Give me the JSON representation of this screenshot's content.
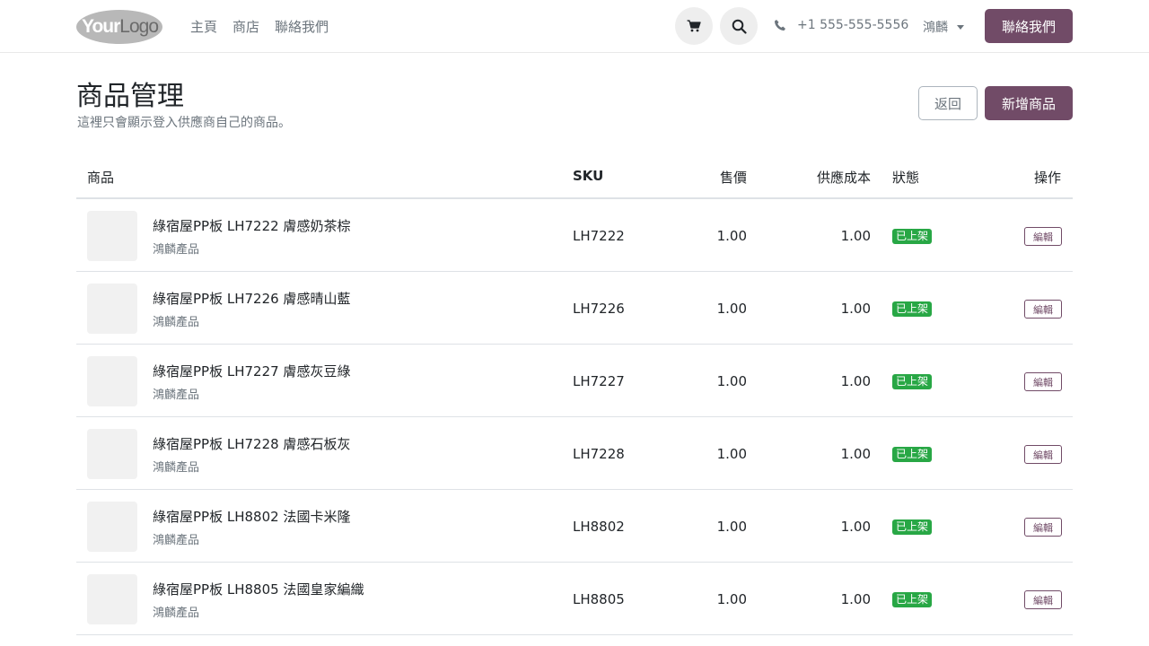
{
  "header": {
    "logo_text_a": "Your",
    "logo_text_b": "Logo",
    "nav": [
      "主頁",
      "商店",
      "聯絡我們"
    ],
    "phone": "+1 555-555-5556",
    "user": "鴻麟",
    "contact_label": "聯絡我們"
  },
  "page": {
    "title": "商品管理",
    "subtitle": "這裡只會顯示登入供應商自己的商品。",
    "back_label": "返回",
    "new_label": "新增商品"
  },
  "table": {
    "headers": {
      "product": "商品",
      "sku": "SKU",
      "price": "售價",
      "cost": "供應成本",
      "status": "狀態",
      "action": "操作"
    },
    "rows": [
      {
        "name": "綠宿屋PP板 LH7222 膚感奶茶棕",
        "vendor": "鴻麟產品",
        "sku": "LH7222",
        "price": "1.00",
        "cost": "1.00",
        "status": "已上架",
        "action": "編輯"
      },
      {
        "name": "綠宿屋PP板 LH7226 膚感晴山藍",
        "vendor": "鴻麟產品",
        "sku": "LH7226",
        "price": "1.00",
        "cost": "1.00",
        "status": "已上架",
        "action": "編輯"
      },
      {
        "name": "綠宿屋PP板 LH7227 膚感灰豆綠",
        "vendor": "鴻麟產品",
        "sku": "LH7227",
        "price": "1.00",
        "cost": "1.00",
        "status": "已上架",
        "action": "編輯"
      },
      {
        "name": "綠宿屋PP板 LH7228 膚感石板灰",
        "vendor": "鴻麟產品",
        "sku": "LH7228",
        "price": "1.00",
        "cost": "1.00",
        "status": "已上架",
        "action": "編輯"
      },
      {
        "name": "綠宿屋PP板 LH8802 法國卡米隆",
        "vendor": "鴻麟產品",
        "sku": "LH8802",
        "price": "1.00",
        "cost": "1.00",
        "status": "已上架",
        "action": "編輯"
      },
      {
        "name": "綠宿屋PP板 LH8805 法國皇家編織",
        "vendor": "鴻麟產品",
        "sku": "LH8805",
        "price": "1.00",
        "cost": "1.00",
        "status": "已上架",
        "action": "編輯"
      }
    ]
  },
  "colors": {
    "brand": "#714b67",
    "status_green": "#28a745"
  },
  "icons": [
    "cart-icon",
    "search-icon",
    "phone-icon",
    "chevron-down-icon"
  ]
}
